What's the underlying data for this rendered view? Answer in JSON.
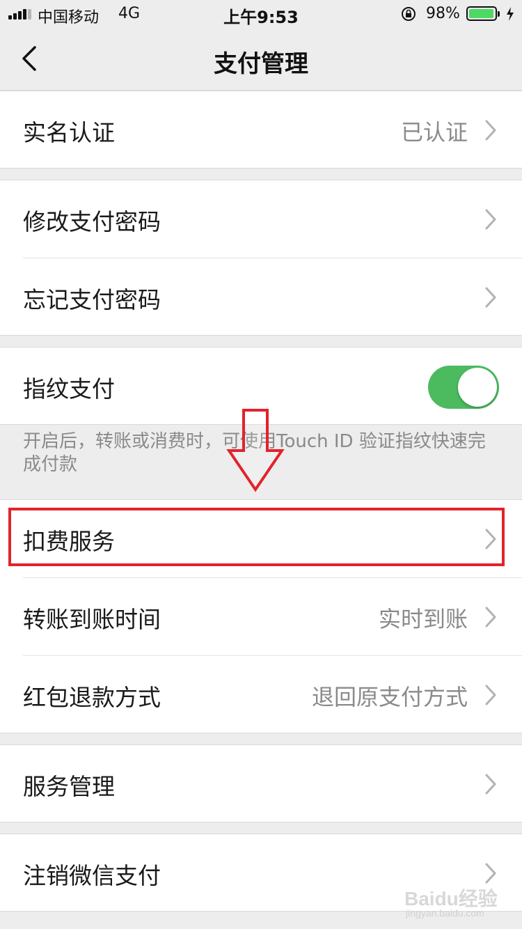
{
  "status_bar": {
    "carrier": "中国移动",
    "network": "4G",
    "time": "上午9:53",
    "battery": "98%",
    "battery_level": 0.98
  },
  "nav": {
    "title": "支付管理"
  },
  "sections": {
    "realname": {
      "label": "实名认证",
      "value": "已认证"
    },
    "change_password": {
      "label": "修改支付密码"
    },
    "forgot_password": {
      "label": "忘记支付密码"
    },
    "fingerprint": {
      "label": "指纹支付",
      "enabled": true,
      "hint": "开启后，转账或消费时，可使用Touch ID 验证指纹快速完成付款"
    },
    "deduction": {
      "label": "扣费服务"
    },
    "transfer_time": {
      "label": "转账到账时间",
      "value": "实时到账"
    },
    "redpacket_refund": {
      "label": "红包退款方式",
      "value": "退回原支付方式"
    },
    "service_manage": {
      "label": "服务管理"
    },
    "cancel_wechat_pay": {
      "label": "注销微信支付"
    }
  },
  "colors": {
    "toggle_on": "#4cbb60",
    "highlight": "#e2232b",
    "background": "#ededed"
  },
  "watermark": {
    "text": "Baidu经验",
    "url": "jingyan.baidu.com"
  }
}
